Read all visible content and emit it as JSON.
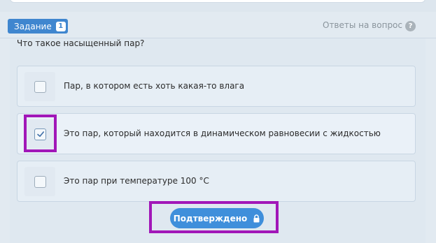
{
  "task": {
    "tab_label": "Задание",
    "badge": "1",
    "answers_link": "Ответы на вопрос",
    "help_icon": "question-circle-icon"
  },
  "question": {
    "text": "Что такое насыщенный пар?",
    "options": [
      {
        "label": "Пар, в котором есть хоть какая-то влага",
        "checked": false
      },
      {
        "label": "Это пар, который находится в динамическом равновесии с жидкостью",
        "checked": true
      },
      {
        "label": "Это пар при температуре 100 °C",
        "checked": false
      }
    ]
  },
  "confirm": {
    "label": "Подтверждено",
    "icon": "lock-icon"
  },
  "colors": {
    "accent": "#3f86cf",
    "button": "#3f8fdb",
    "highlight": "#a117b8"
  }
}
